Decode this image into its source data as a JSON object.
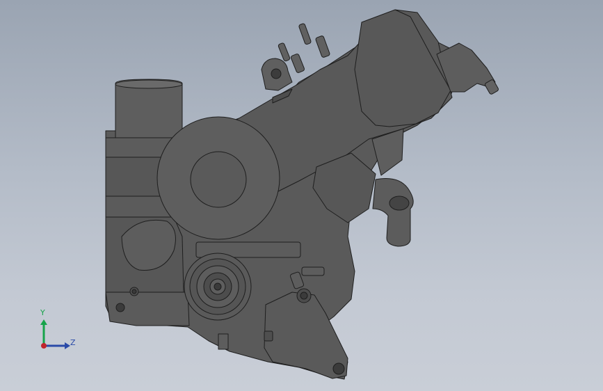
{
  "view": {
    "background_top": "#9aa4b2",
    "background_bottom": "#c9ced7",
    "model_fill": "#5b5b5b",
    "model_edge": "#1e1e1e"
  },
  "triad": {
    "y_label": "Y",
    "z_label": "Z",
    "y_color": "#16a34a",
    "z_color": "#2a4aa8",
    "x_color": "#c0262d"
  }
}
